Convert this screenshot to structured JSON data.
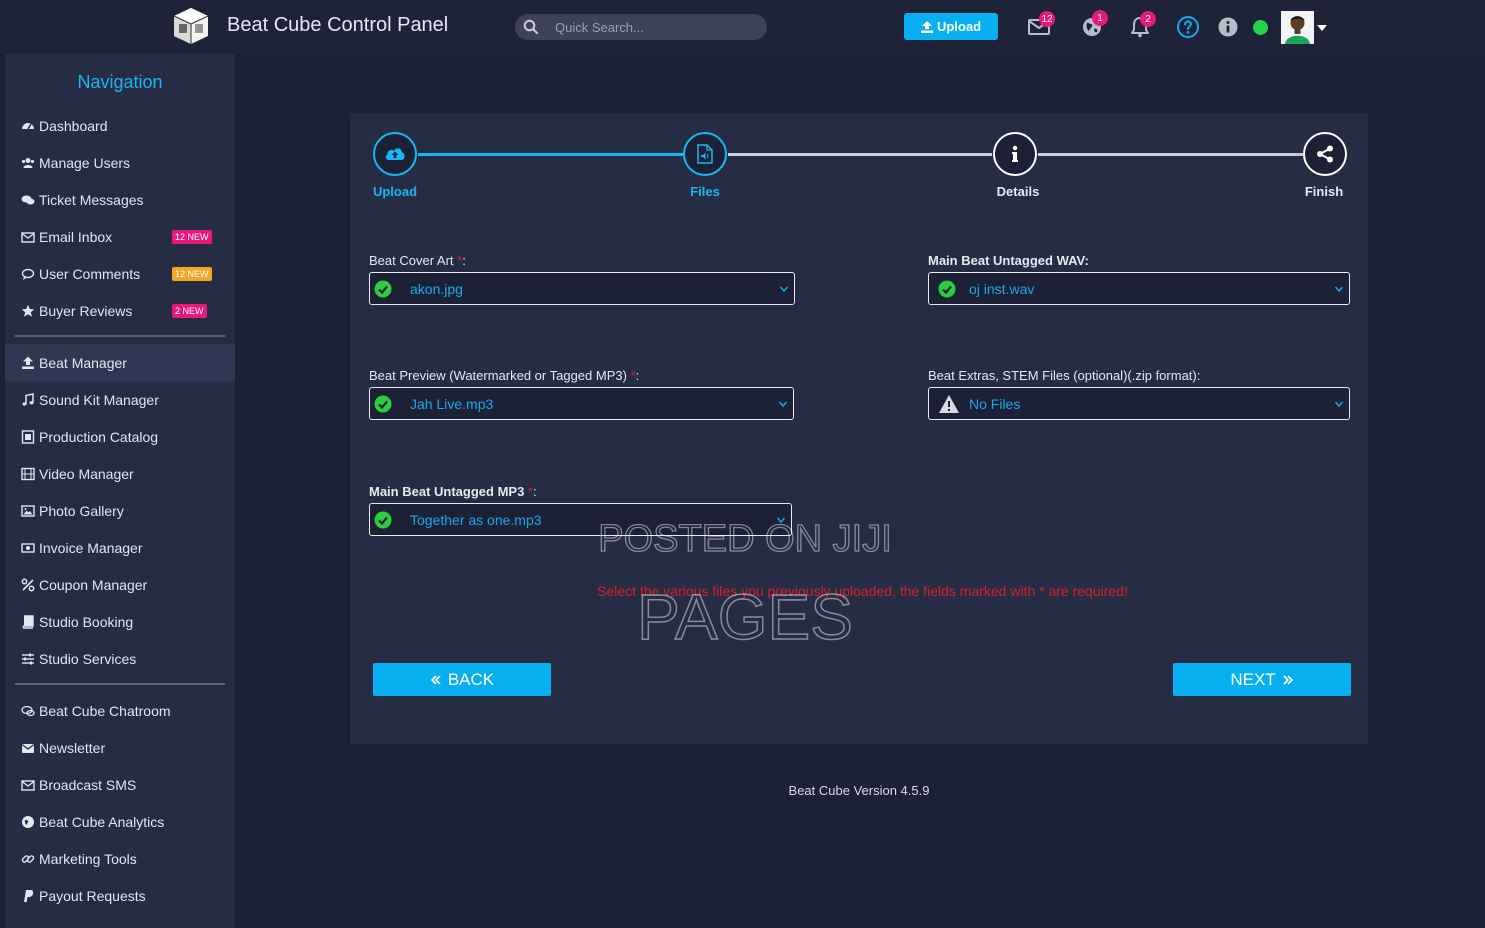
{
  "app": {
    "title": "Beat Cube Control Panel",
    "version": "Beat Cube Version 4.5.9"
  },
  "topbar": {
    "search_placeholder": "Quick Search...",
    "upload_label": "Upload",
    "mail_count": "12",
    "globe_count": "1",
    "bell_count": "2",
    "status_color": "#27d14a"
  },
  "sidebar": {
    "title": "Navigation",
    "group1": [
      {
        "label": "Dashboard",
        "icon": "dashboard-icon"
      },
      {
        "label": "Manage Users",
        "icon": "users-icon"
      },
      {
        "label": "Ticket Messages",
        "icon": "comments-icon"
      },
      {
        "label": "Email Inbox",
        "icon": "envelope-icon",
        "badge": "12 NEW",
        "badge_color": "#e8197d"
      },
      {
        "label": "User Comments",
        "icon": "comment-icon",
        "badge": "12 NEW",
        "badge_color": "#f5a623"
      },
      {
        "label": "Buyer Reviews",
        "icon": "star-icon",
        "badge": "2 NEW",
        "badge_color": "#e8197d"
      }
    ],
    "group2": [
      {
        "label": "Beat Manager",
        "icon": "upload-icon",
        "active": true
      },
      {
        "label": "Sound Kit Manager",
        "icon": "music-icon"
      },
      {
        "label": "Production Catalog",
        "icon": "catalog-icon"
      },
      {
        "label": "Video Manager",
        "icon": "film-icon"
      },
      {
        "label": "Photo Gallery",
        "icon": "image-icon"
      },
      {
        "label": "Invoice Manager",
        "icon": "invoice-icon"
      },
      {
        "label": "Coupon Manager",
        "icon": "percent-icon"
      },
      {
        "label": "Studio Booking",
        "icon": "book-icon"
      },
      {
        "label": "Studio Services",
        "icon": "sliders-icon"
      }
    ],
    "group3": [
      {
        "label": "Beat Cube Chatroom",
        "icon": "chat-icon"
      },
      {
        "label": "Newsletter",
        "icon": "newsletter-icon"
      },
      {
        "label": "Broadcast SMS",
        "icon": "envelope-icon"
      },
      {
        "label": "Beat Cube Analytics",
        "icon": "globe-icon"
      },
      {
        "label": "Marketing Tools",
        "icon": "link-icon"
      },
      {
        "label": "Payout Requests",
        "icon": "paypal-icon"
      }
    ]
  },
  "wizard": {
    "steps": [
      {
        "label": "Upload",
        "state": "done"
      },
      {
        "label": "Files",
        "state": "current"
      },
      {
        "label": "Details",
        "state": "todo"
      },
      {
        "label": "Finish",
        "state": "todo"
      }
    ],
    "fields": {
      "cover_art": {
        "label": "Beat Cover Art",
        "value": "akon.jpg",
        "status": "ok"
      },
      "wav": {
        "label": "Main Beat Untagged WAV:",
        "value": "oj inst.wav",
        "status": "ok"
      },
      "preview": {
        "label": "Beat Preview (Watermarked or Tagged MP3)",
        "value": "Jah Live.mp3",
        "status": "ok"
      },
      "extras": {
        "label": "Beat Extras, STEM Files (optional)(.zip format):",
        "value": "No Files",
        "status": "warning"
      },
      "mp3": {
        "label": "Main Beat Untagged MP3",
        "value": "Together as one.mp3",
        "status": "ok"
      }
    },
    "required_mark": "*",
    "colon": ":",
    "message": "Select the various files you previously uploaded, the fields marked with * are required!",
    "back_label": "BACK",
    "next_label": "NEXT"
  },
  "watermark": {
    "line1": "POSTED ON JIJI",
    "line2": "PAGES"
  }
}
